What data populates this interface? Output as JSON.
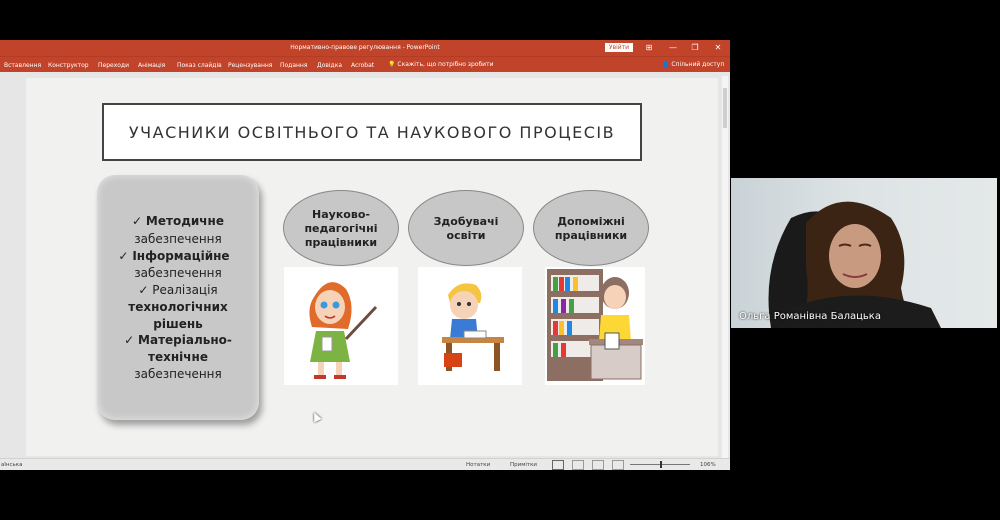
{
  "window": {
    "title": "Нормативно-правове регулювання  -  PowerPoint",
    "signin_label": "Увійти",
    "buttons": [
      "⊞",
      "—",
      "❐",
      "✕"
    ]
  },
  "ribbon": {
    "tabs": [
      "Вставлення",
      "Конструктор",
      "Переходи",
      "Анімація",
      "Показ слайдів",
      "Рецензування",
      "Подання",
      "Довідка",
      "Acrobat"
    ],
    "tell_me": "Скажіть, що потрібно зробити",
    "share": "Спільний доступ"
  },
  "slide": {
    "title": "УЧАСНИКИ ОСВІТНЬОГО ТА НАУКОВОГО ПРОЦЕСІВ",
    "left_box": {
      "lines": [
        {
          "text": "✓ Методичне",
          "bold_part": "Методичне"
        },
        {
          "text": "забезпечення"
        },
        {
          "text": "✓ Інформаційне"
        },
        {
          "text": "забезпечення"
        },
        {
          "text": "✓ Реалізація"
        },
        {
          "text": "технологічних"
        },
        {
          "text": "рішень"
        },
        {
          "text": "✓ Матеріально-"
        },
        {
          "text": "технічне"
        },
        {
          "text": "забезпечення"
        }
      ],
      "check": "✓",
      "items": [
        {
          "bold": "Методичне",
          "normal": "забезпечення"
        },
        {
          "bold": "Інформаційне",
          "normal": "забезпечення"
        },
        {
          "pre": "Реалізація",
          "bold1": "технологічних",
          "bold2": "рішень"
        },
        {
          "bold1": "Матеріально-",
          "bold2": "технічне",
          "normal": "забезпечення"
        }
      ]
    },
    "groups": [
      {
        "lines": [
          "Науково-",
          "педагогічні",
          "працівники"
        ]
      },
      {
        "lines": [
          "Здобувачі",
          "освіти"
        ]
      },
      {
        "lines": [
          "Допоміжні",
          "працівники"
        ]
      }
    ]
  },
  "statusbar": {
    "slide_info": "аїнська",
    "notes": "Нотатки",
    "comments": "Примітки",
    "zoom": "106%"
  },
  "video": {
    "participant_name": "Ольга Романівна Балацька"
  },
  "colors": {
    "accent": "#c0432a",
    "slide_bg": "#f1f1f0",
    "ellipse": "#c7c7c7"
  }
}
